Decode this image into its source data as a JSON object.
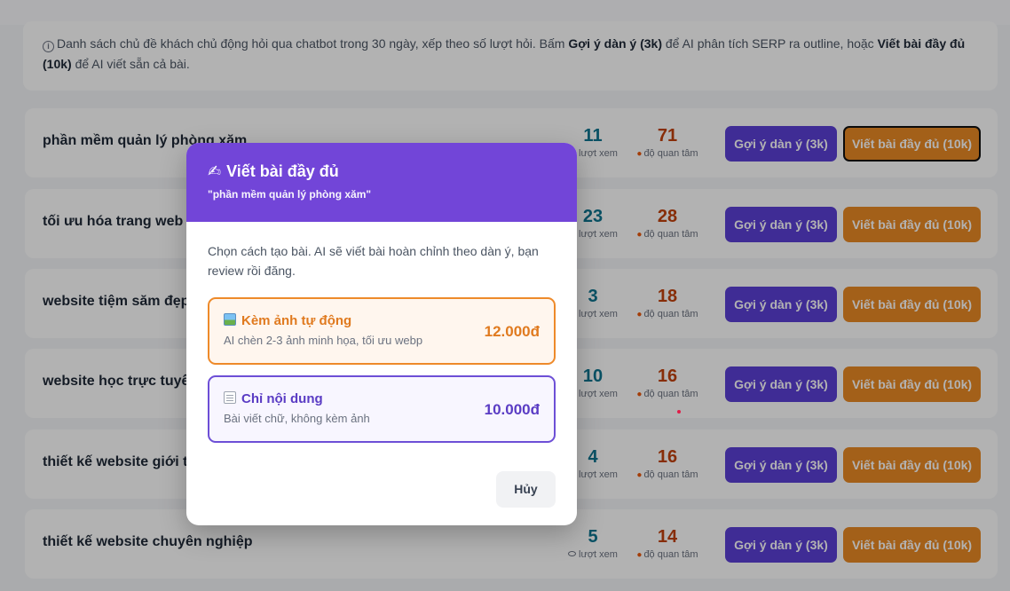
{
  "info": {
    "text_1": "Danh sách chủ đề khách chủ động hỏi qua chatbot trong 30 ngày, xếp theo số lượt hỏi. Bấm ",
    "bold_1": "Gợi ý dàn ý (3k)",
    "text_2": " để AI phân tích SERP ra outline, hoặc ",
    "bold_2": "Viết bài đầy đủ (10k)",
    "text_3": " để AI viết sẵn cả bài."
  },
  "labels": {
    "views": "lượt xem",
    "interest": "độ quan tâm",
    "suggest_button": "Gợi ý dàn ý (3k)",
    "write_button": "Viết bài đầy đủ (10k)"
  },
  "topics": [
    {
      "title": "phần mềm quản lý phòng xăm",
      "views": "11",
      "interest": "71"
    },
    {
      "title": "tối ưu hóa trang web cho tiệm xăm",
      "views": "23",
      "interest": "28"
    },
    {
      "title": "website tiệm săm đẹp",
      "views": "3",
      "interest": "18"
    },
    {
      "title": "website học trực tuyến",
      "views": "10",
      "interest": "16"
    },
    {
      "title": "thiết kế website giới thiệu",
      "views": "4",
      "interest": "16"
    },
    {
      "title": "thiết kế website chuyên nghiệp",
      "views": "5",
      "interest": "14"
    }
  ],
  "modal": {
    "title": "Viết bài đầy đủ",
    "title_icon": "writing-hand-icon",
    "subtitle": "\"phần mềm quản lý phòng xăm\"",
    "description": "Chọn cách tạo bài. AI sẽ viết bài hoàn chỉnh theo dàn ý, bạn review rồi đăng.",
    "options": [
      {
        "name": "Kèm ảnh tự động",
        "desc": "AI chèn 2-3 ảnh minh họa, tối ưu webp",
        "price": "12.000đ",
        "icon": "picture-icon"
      },
      {
        "name": "Chỉ nội dung",
        "desc": "Bài viết chữ, không kèm ảnh",
        "price": "10.000đ",
        "icon": "memo-icon"
      }
    ],
    "cancel": "Hủy"
  },
  "colors": {
    "primary_purple": "#5b3fd6",
    "modal_header": "#7245d8",
    "orange": "#ea8a25",
    "views_teal": "#0e7490",
    "interest_orange": "#c2410c"
  }
}
